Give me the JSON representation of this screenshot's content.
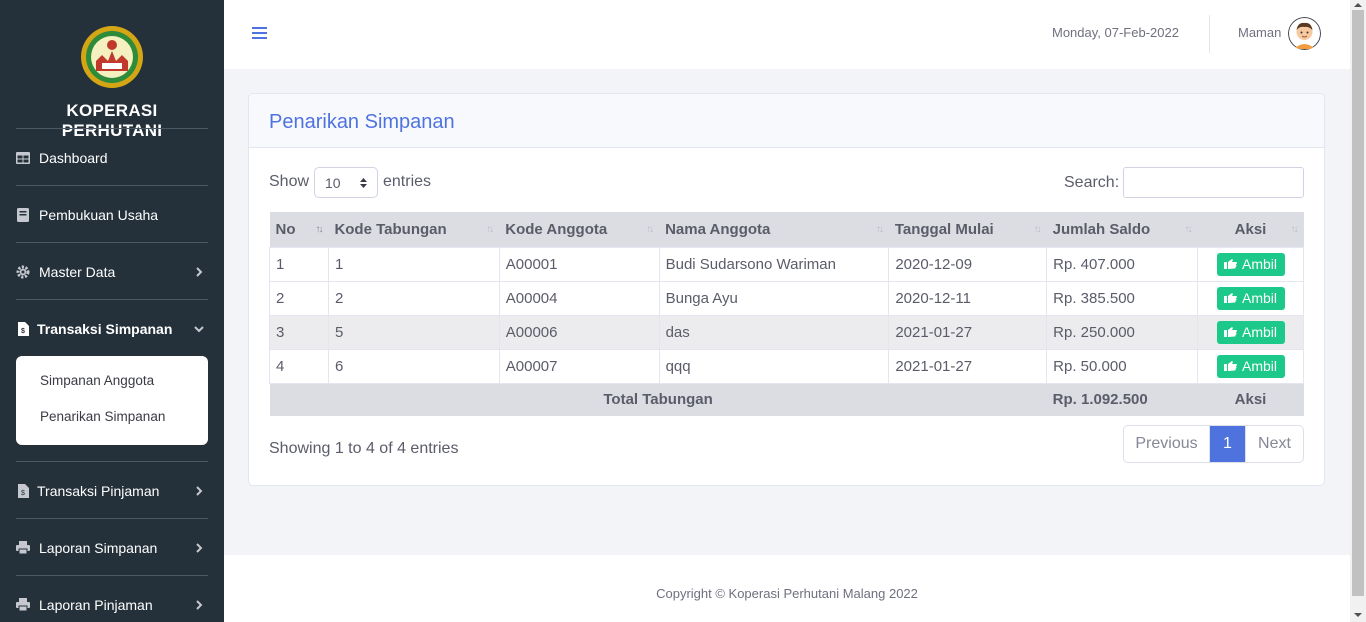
{
  "sidebar": {
    "brand": "KOPERASI PERHUTANI",
    "items": [
      {
        "label": "Dashboard",
        "icon": "table-icon"
      },
      {
        "label": "Pembukuan Usaha",
        "icon": "book-icon"
      },
      {
        "label": "Master Data",
        "icon": "gear-icon"
      },
      {
        "label": "Transaksi Simpanan",
        "icon": "file-icon"
      },
      {
        "label": "Transaksi Pinjaman",
        "icon": "file-icon"
      },
      {
        "label": "Laporan Simpanan",
        "icon": "print-icon"
      },
      {
        "label": "Laporan Pinjaman",
        "icon": "print-icon"
      }
    ],
    "submenu": [
      "Simpanan Anggota",
      "Penarikan Simpanan"
    ]
  },
  "topbar": {
    "date": "Monday, 07-Feb-2022",
    "username": "Maman"
  },
  "card": {
    "title": "Penarikan Simpanan",
    "show": "Show",
    "length_value": "10",
    "entries": "entries",
    "search_label": "Search:"
  },
  "table": {
    "headers": [
      "No",
      "Kode Tabungan",
      "Kode Anggota",
      "Nama Anggota",
      "Tanggal Mulai",
      "Jumlah Saldo",
      "Aksi"
    ],
    "rows": [
      {
        "no": "1",
        "kode_tabungan": "1",
        "kode_anggota": "A00001",
        "nama": "Budi Sudarsono Wariman",
        "tanggal": "2020-12-09",
        "saldo": "Rp. 407.000"
      },
      {
        "no": "2",
        "kode_tabungan": "2",
        "kode_anggota": "A00004",
        "nama": "Bunga Ayu",
        "tanggal": "2020-12-11",
        "saldo": "Rp. 385.500"
      },
      {
        "no": "3",
        "kode_tabungan": "5",
        "kode_anggota": "A00006",
        "nama": "das",
        "tanggal": "2021-01-27",
        "saldo": "Rp. 250.000"
      },
      {
        "no": "4",
        "kode_tabungan": "6",
        "kode_anggota": "A00007",
        "nama": "qqq",
        "tanggal": "2021-01-27",
        "saldo": "Rp. 50.000"
      }
    ],
    "button_label": "Ambil",
    "footer_label": "Total Tabungan",
    "footer_total": "Rp. 1.092.500",
    "footer_aksi": "Aksi"
  },
  "pagination": {
    "info": "Showing 1 to 4 of 4 entries",
    "previous": "Previous",
    "current": "1",
    "next": "Next"
  },
  "footer": {
    "copyright": "Copyright © Koperasi Perhutani Malang 2022"
  },
  "colors": {
    "sidebar_bg": "#24303a",
    "primary": "#4e73df",
    "success": "#1cc88a"
  }
}
